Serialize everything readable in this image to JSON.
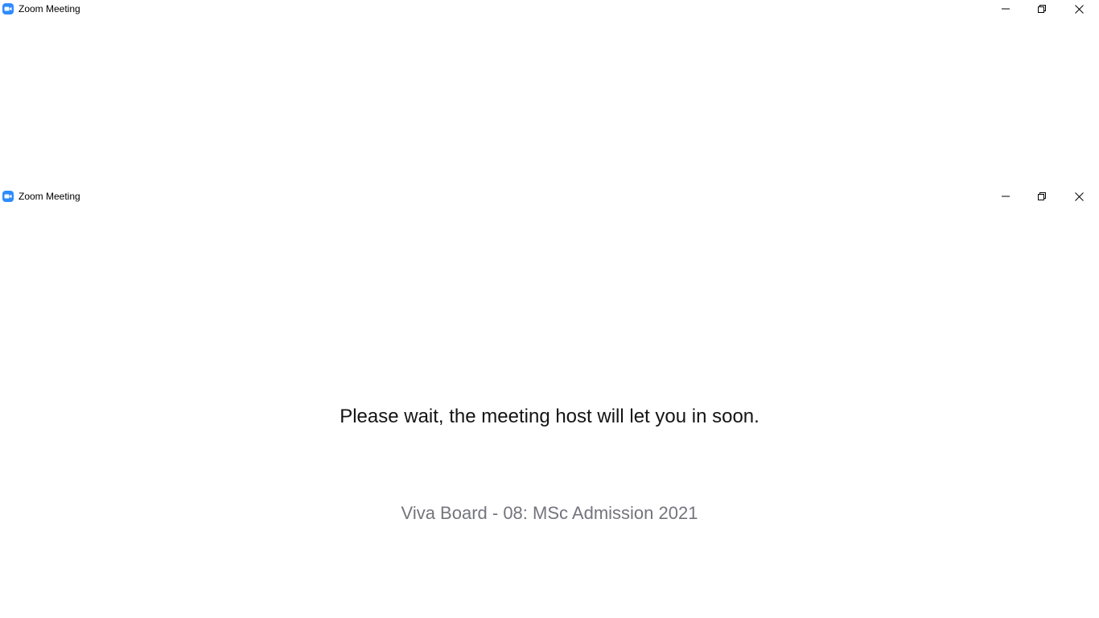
{
  "windows": [
    {
      "title": "Zoom Meeting",
      "icon": "zoom-camera-icon",
      "controls": [
        "minimize-icon",
        "restore-icon",
        "close-icon"
      ]
    },
    {
      "title": "Zoom Meeting",
      "icon": "zoom-camera-icon",
      "controls": [
        "minimize-icon",
        "restore-icon",
        "close-icon"
      ]
    }
  ],
  "waiting_room": {
    "message": "Please wait, the meeting host will let you in soon.",
    "meeting_name": "Viva Board - 08: MSc Admission 2021"
  },
  "colors": {
    "zoom_blue": "#2d8cff",
    "message_text": "#141414",
    "meeting_name_text": "#74747e"
  }
}
